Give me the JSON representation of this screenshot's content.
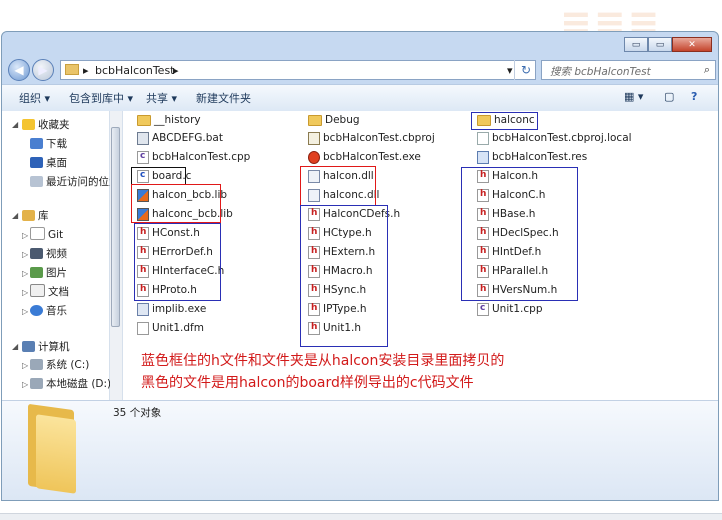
{
  "window": {
    "min": "▭",
    "max": "▭",
    "close": "✕"
  },
  "address": {
    "path_sep": "▸",
    "current": "bcbHalconTest",
    "end_sep": "▸",
    "dropdown": "▾",
    "refresh": "↻"
  },
  "search": {
    "placeholder": "搜索 bcbHalconTest",
    "icon": "⌕"
  },
  "toolbar": {
    "organize": "组织 ▾",
    "include": "包含到库中 ▾",
    "share": "共享 ▾",
    "new_folder": "新建文件夹",
    "view": "▦ ▾",
    "pane": "▢",
    "help": "?"
  },
  "nav": {
    "favorites": "收藏夹",
    "downloads": "下载",
    "desktop": "桌面",
    "recent": "最近访问的位置",
    "libraries": "库",
    "git": "Git",
    "videos": "视频",
    "pictures": "图片",
    "documents": "文档",
    "music": "音乐",
    "computer": "计算机",
    "system_c": "系统 (C:)",
    "local_d": "本地磁盘 (D:)"
  },
  "files": {
    "col1": [
      "__history",
      "ABCDEFG.bat",
      "bcbHalconTest.cpp",
      "board.c",
      "halcon_bcb.lib",
      "halconc_bcb.lib",
      "HConst.h",
      "HErrorDef.h",
      "HInterfaceC.h",
      "HProto.h",
      "implib.exe",
      "Unit1.dfm"
    ],
    "col2": [
      "Debug",
      "bcbHalconTest.cbproj",
      "bcbHalconTest.exe",
      "halcon.dll",
      "halconc.dll",
      "HalconCDefs.h",
      "HCtype.h",
      "HExtern.h",
      "HMacro.h",
      "HSync.h",
      "IPType.h",
      "Unit1.h"
    ],
    "col3": [
      "halconc",
      "bcbHalconTest.cbproj.local",
      "bcbHalconTest.res",
      "Halcon.h",
      "HalconC.h",
      "HBase.h",
      "HDeclSpec.h",
      "HIntDef.h",
      "HParallel.h",
      "HVersNum.h",
      "Unit1.cpp"
    ]
  },
  "annotation": {
    "line1": "蓝色框住的h文件和文件夹是从halcon安装目录里面拷贝的",
    "line2": "黑色的文件是用halcon的board样例导出的c代码文件"
  },
  "details": {
    "count": "35 个对象"
  },
  "colors": {
    "blue_box": "#2a2fb5",
    "red_box": "#e01818",
    "black_box": "#111111",
    "annotation": "#d21a1a"
  }
}
